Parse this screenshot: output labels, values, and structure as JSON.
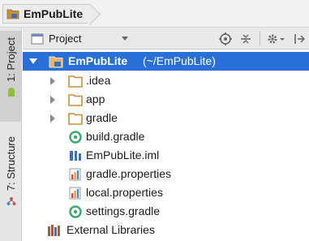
{
  "breadcrumb": {
    "label": "EmPubLite"
  },
  "side_tabs": [
    {
      "label": "1: Project"
    },
    {
      "label": "7: Structure"
    }
  ],
  "panel": {
    "view_label": "Project"
  },
  "tree": {
    "root_name": "EmPubLite",
    "root_path": "(~/EmPubLite)",
    "items": [
      {
        "label": ".idea",
        "icon": "folder-icon"
      },
      {
        "label": "app",
        "icon": "folder-icon"
      },
      {
        "label": "gradle",
        "icon": "folder-icon"
      },
      {
        "label": "build.gradle",
        "icon": "gradle-icon"
      },
      {
        "label": "EmPubLite.iml",
        "icon": "iml-file-icon"
      },
      {
        "label": "gradle.properties",
        "icon": "properties-icon"
      },
      {
        "label": "local.properties",
        "icon": "properties-icon"
      },
      {
        "label": "settings.gradle",
        "icon": "gradle-icon"
      },
      {
        "label": "External Libraries",
        "icon": "libraries-icon"
      }
    ]
  },
  "colors": {
    "selection": "#2a6fd6",
    "folder": "#c58f3a",
    "gradle": "#3aa86b",
    "iml": "#3b6fb6"
  }
}
